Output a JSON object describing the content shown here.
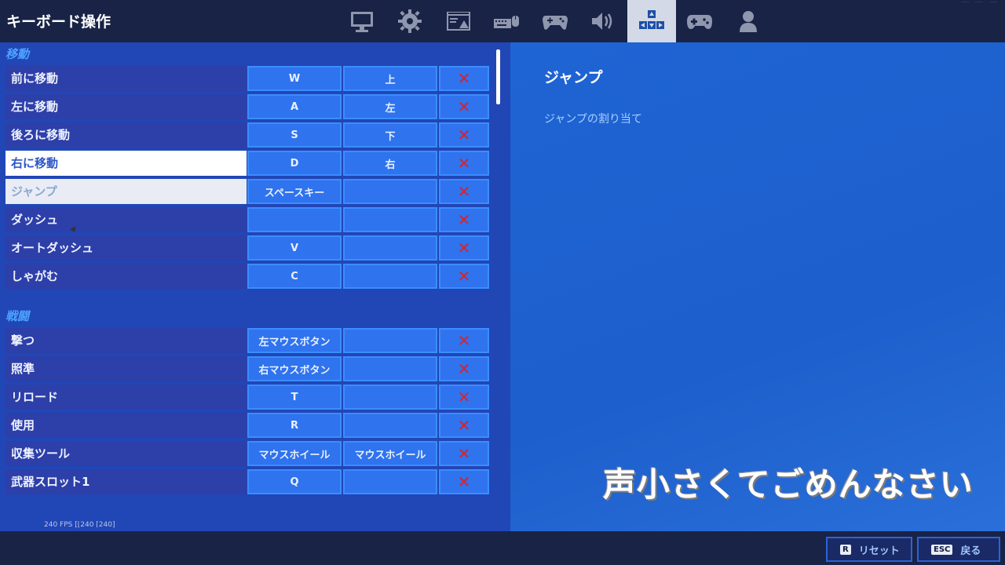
{
  "header": {
    "title": "キーボード操作",
    "tabs": [
      {
        "name": "tab-display",
        "icon": "monitor-icon"
      },
      {
        "name": "tab-game",
        "icon": "gear-icon"
      },
      {
        "name": "tab-brightness",
        "icon": "image-icon"
      },
      {
        "name": "tab-accessibility",
        "icon": "keyboard-mouse-icon"
      },
      {
        "name": "tab-input",
        "icon": "controller-keys-icon"
      },
      {
        "name": "tab-audio",
        "icon": "speaker-icon"
      },
      {
        "name": "tab-keyboard",
        "icon": "keys-icon",
        "active": true
      },
      {
        "name": "tab-controller",
        "icon": "gamepad-icon"
      },
      {
        "name": "tab-account",
        "icon": "person-icon"
      }
    ]
  },
  "sections": {
    "movement": {
      "title": "移動",
      "rows": [
        {
          "label": "前に移動",
          "key1": "W",
          "key2": "上"
        },
        {
          "label": "左に移動",
          "key1": "A",
          "key2": "左"
        },
        {
          "label": "後ろに移動",
          "key1": "S",
          "key2": "下"
        },
        {
          "label": "右に移動",
          "key1": "D",
          "key2": "右"
        },
        {
          "label": "ジャンプ",
          "key1": "スペースキー",
          "key2": ""
        },
        {
          "label": "ダッシュ",
          "key1": "",
          "key2": ""
        },
        {
          "label": "オートダッシュ",
          "key1": "V",
          "key2": ""
        },
        {
          "label": "しゃがむ",
          "key1": "C",
          "key2": ""
        }
      ]
    },
    "combat": {
      "title": "戦闘",
      "rows": [
        {
          "label": "撃つ",
          "key1": "左マウスボタン",
          "key2": ""
        },
        {
          "label": "照準",
          "key1": "右マウスボタン",
          "key2": ""
        },
        {
          "label": "リロード",
          "key1": "T",
          "key2": ""
        },
        {
          "label": "使用",
          "key1": "R",
          "key2": ""
        },
        {
          "label": "収集ツール",
          "key1": "マウスホイール",
          "key2": "マウスホイール"
        },
        {
          "label": "武器スロット1",
          "key1": "Q",
          "key2": ""
        }
      ]
    }
  },
  "clear_glyph": "✕",
  "fps": "240 FPS [⌊240 ⌈240]",
  "detail": {
    "title": "ジャンプ",
    "description": "ジャンプの割り当て"
  },
  "overlay_caption": "声小さくてごめんなさい",
  "footer": {
    "reset_key": "R",
    "reset_label": "リセット",
    "back_key": "ESC",
    "back_label": "戻る"
  }
}
